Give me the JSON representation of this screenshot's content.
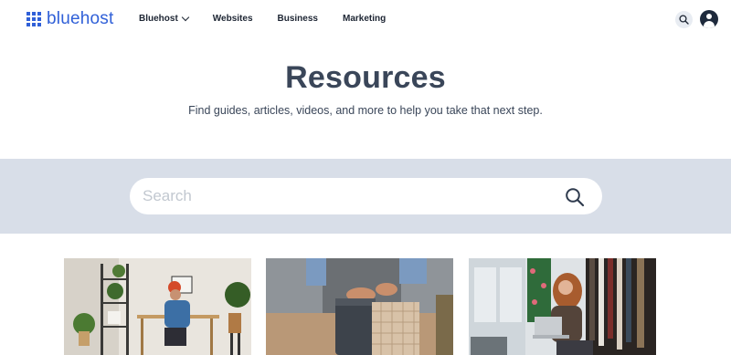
{
  "header": {
    "logo_text": "bluehost",
    "nav": [
      {
        "label": "Bluehost",
        "has_dropdown": true
      },
      {
        "label": "Websites",
        "has_dropdown": false
      },
      {
        "label": "Business",
        "has_dropdown": false
      },
      {
        "label": "Marketing",
        "has_dropdown": false
      }
    ],
    "icons": [
      "search-icon",
      "account-icon"
    ]
  },
  "hero": {
    "title": "Resources",
    "subtitle": "Find guides, articles, videos, and more to help you take that next step."
  },
  "search": {
    "placeholder": "Search",
    "value": "",
    "icon": "search-icon"
  },
  "cards": [
    {
      "image": "man-working-at-desk-photo"
    },
    {
      "image": "hands-holding-shopping-bags-photo"
    },
    {
      "image": "woman-with-laptop-in-boutique-photo"
    }
  ],
  "colors": {
    "brand": "#3060d8",
    "title": "#3a4659",
    "search_band": "#d8dee8"
  }
}
